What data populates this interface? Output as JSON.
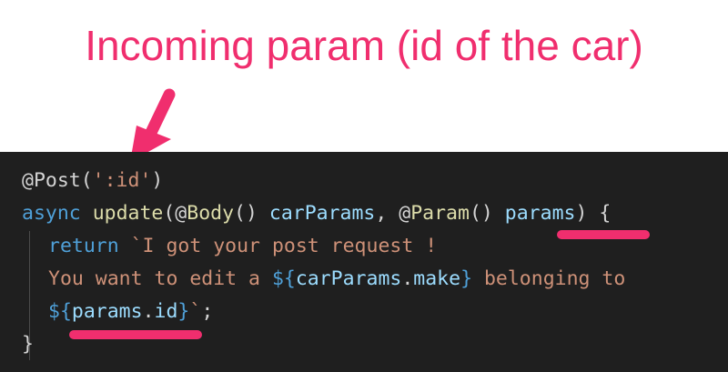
{
  "annotation": {
    "title": "Incoming param (id of the car)",
    "color": "#f02e6e"
  },
  "code_panel": {
    "background": "#1f1f1f",
    "lines": [
      {
        "parts": [
          {
            "text": "@Post(",
            "role": "pun"
          },
          {
            "text": "':id'",
            "role": "str"
          },
          {
            "text": ")",
            "role": "pun"
          }
        ]
      },
      {
        "parts": [
          {
            "text": "async",
            "role": "kw"
          },
          {
            "text": " ",
            "role": "pun"
          },
          {
            "text": "update",
            "role": "fn"
          },
          {
            "text": "(@",
            "role": "pun"
          },
          {
            "text": "Body",
            "role": "fn"
          },
          {
            "text": "() ",
            "role": "pun"
          },
          {
            "text": "carParams",
            "role": "var"
          },
          {
            "text": ", @",
            "role": "pun"
          },
          {
            "text": "Param",
            "role": "fn"
          },
          {
            "text": "() ",
            "role": "pun"
          },
          {
            "text": "params",
            "role": "var"
          },
          {
            "text": ") {",
            "role": "pun"
          }
        ]
      },
      {
        "indent": true,
        "parts": [
          {
            "text": "return",
            "role": "kw"
          },
          {
            "text": " `I got your post request !",
            "role": "str"
          }
        ]
      },
      {
        "indent": true,
        "parts": [
          {
            "text": "You want to edit a ",
            "role": "str"
          },
          {
            "text": "${",
            "role": "kw"
          },
          {
            "text": "carParams",
            "role": "var"
          },
          {
            "text": ".",
            "role": "pun"
          },
          {
            "text": "make",
            "role": "var"
          },
          {
            "text": "}",
            "role": "kw"
          },
          {
            "text": " belonging to",
            "role": "str"
          }
        ]
      },
      {
        "indent": true,
        "parts": [
          {
            "text": "${",
            "role": "kw"
          },
          {
            "text": "params",
            "role": "var"
          },
          {
            "text": ".",
            "role": "pun"
          },
          {
            "text": "id",
            "role": "var"
          },
          {
            "text": "}",
            "role": "kw"
          },
          {
            "text": "`",
            "role": "str"
          },
          {
            "text": ";",
            "role": "pun"
          }
        ]
      },
      {
        "parts": [
          {
            "text": "}",
            "role": "pun"
          }
        ]
      }
    ]
  }
}
